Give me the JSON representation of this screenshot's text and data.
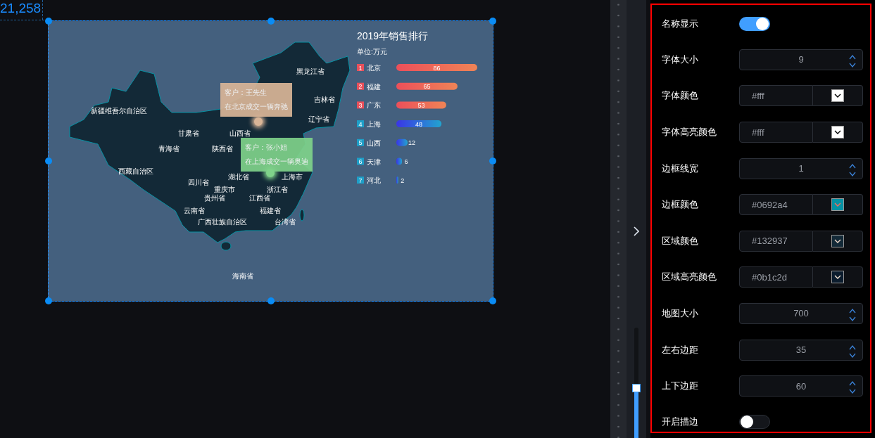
{
  "canvas": {
    "coordinate": "21,258"
  },
  "map": {
    "province_labels": [
      "黑龙江省",
      "吉林省",
      "新疆维吾尔自治区",
      "辽宁省",
      "甘肃省",
      "山西省",
      "青海省",
      "陕西省",
      "西藏自治区",
      "湖北省",
      "上海市",
      "四川省",
      "重庆市",
      "浙江省",
      "贵州省",
      "江西省",
      "云南省",
      "福建省",
      "广西壮族自治区",
      "台湾省",
      "海南省"
    ],
    "markers": [
      {
        "customer": "客户：王先生",
        "deal": "在北京成交一辆奔驰",
        "color": "#d9b597"
      },
      {
        "customer": "客户：张小姐",
        "deal": "在上海成交一辆奥迪",
        "color": "#7fd28a"
      }
    ]
  },
  "ranking": {
    "unit": "单位:万元",
    "ranks": [
      {
        "label": "1",
        "color": "#e8505b",
        "kind": "top"
      },
      {
        "label": "2",
        "color": "#e8505b",
        "kind": "top"
      },
      {
        "label": "3",
        "color": "#e8505b",
        "kind": "top"
      },
      {
        "label": "4",
        "color": "#1e9fc8",
        "kind": "normal"
      },
      {
        "label": "5",
        "color": "#1e9fc8",
        "kind": "normal"
      },
      {
        "label": "6",
        "color": "#1e9fc8",
        "kind": "normal"
      },
      {
        "label": "7",
        "color": "#1e9fc8",
        "kind": "normal"
      }
    ],
    "chart_data": {
      "type": "bar",
      "orientation": "horizontal",
      "title": "2019年销售排行",
      "categories": [
        "北京",
        "福建",
        "广东",
        "上海",
        "山西",
        "天津",
        "河北"
      ],
      "values": [
        86,
        65,
        53,
        48,
        12,
        6,
        2
      ],
      "data_labels": true
    }
  },
  "zoom_slider": {
    "level": 0.45
  },
  "settings": {
    "rows": [
      {
        "kind": "switch",
        "label": "名称显示",
        "on": true
      },
      {
        "kind": "number",
        "label": "字体大小",
        "value": "9"
      },
      {
        "kind": "color",
        "label": "字体颜色",
        "value": "#fff",
        "color": "#ffffff"
      },
      {
        "kind": "color",
        "label": "字体高亮颜色",
        "value": "#fff",
        "color": "#ffffff"
      },
      {
        "kind": "number",
        "label": "边框线宽",
        "value": "1"
      },
      {
        "kind": "color",
        "label": "边框颜色",
        "value": "#0692a4",
        "color": "#0692a4"
      },
      {
        "kind": "color",
        "label": "区域颜色",
        "value": "#132937",
        "color": "#132937"
      },
      {
        "kind": "color",
        "label": "区域高亮颜色",
        "value": "#0b1c2d",
        "color": "#0b1c2d"
      },
      {
        "kind": "number",
        "label": "地图大小",
        "value": "700"
      },
      {
        "kind": "number",
        "label": "左右边距",
        "value": "35"
      },
      {
        "kind": "number",
        "label": "上下边距",
        "value": "60"
      },
      {
        "kind": "switch",
        "label": "开启描边",
        "on": false
      }
    ]
  }
}
